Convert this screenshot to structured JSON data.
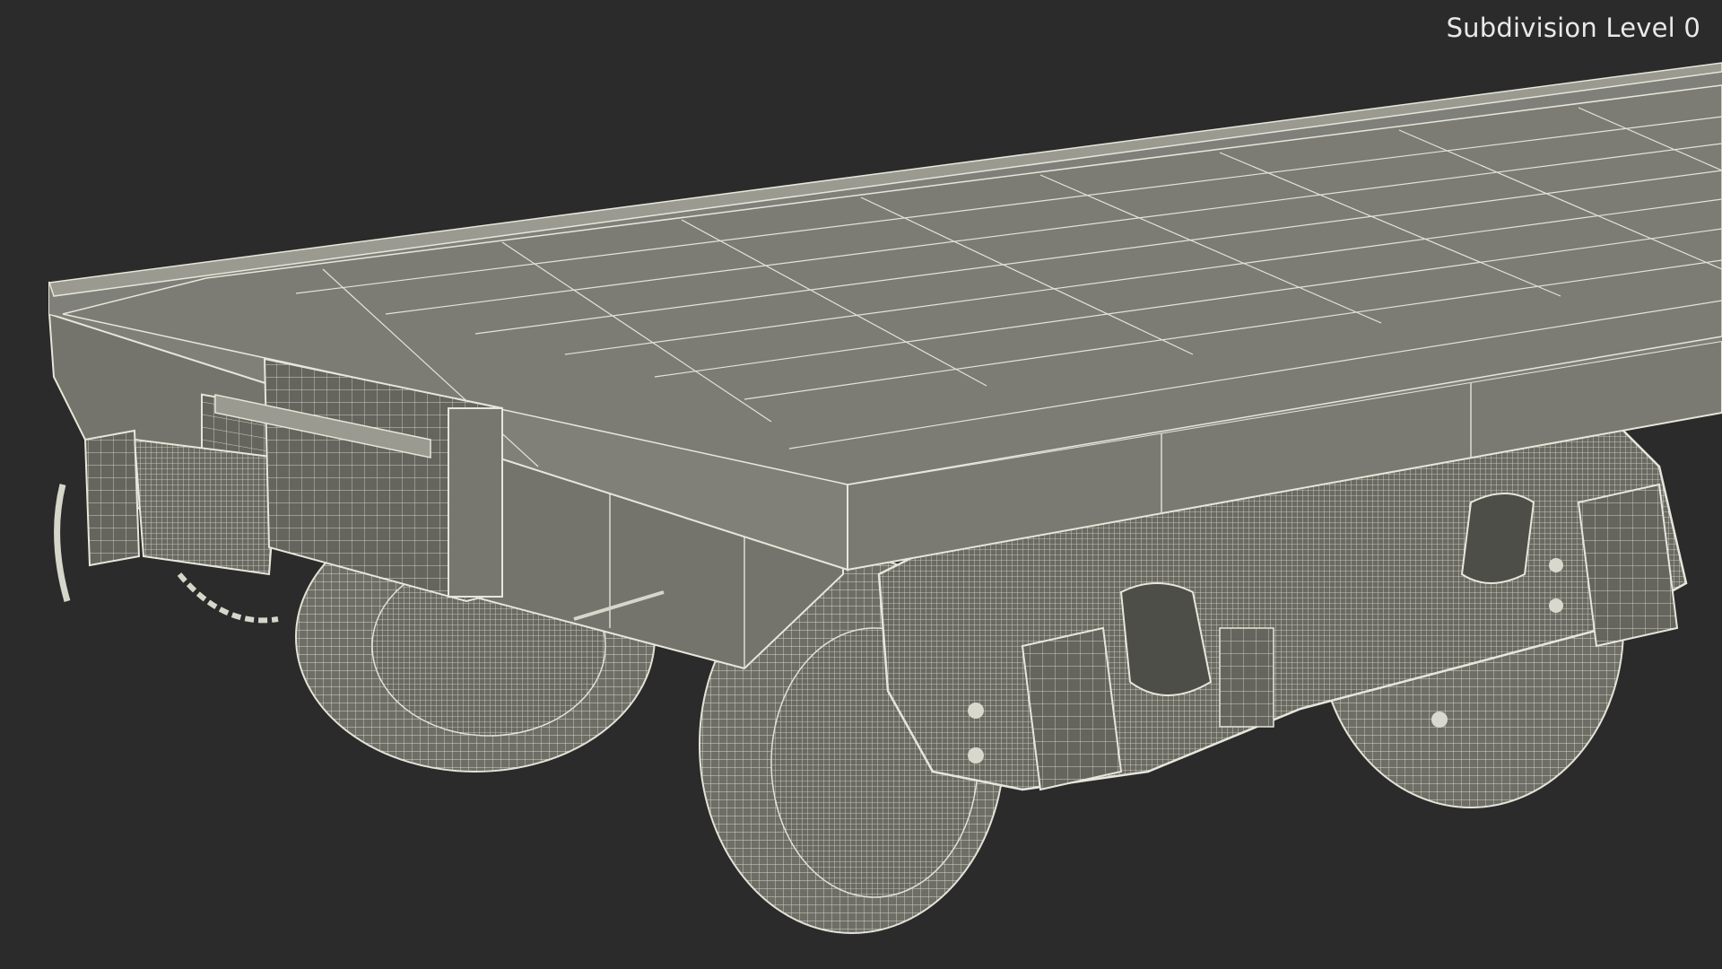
{
  "overlay": {
    "subdivision_label": "Subdivision Level 0"
  },
  "scene": {
    "subject": "flatcar-wireframe-render",
    "colors": {
      "background": "#2b2b2b",
      "surface": "#7d7d74",
      "surface_dark": "#5f5f58",
      "wire": "#dcdcd0"
    }
  }
}
